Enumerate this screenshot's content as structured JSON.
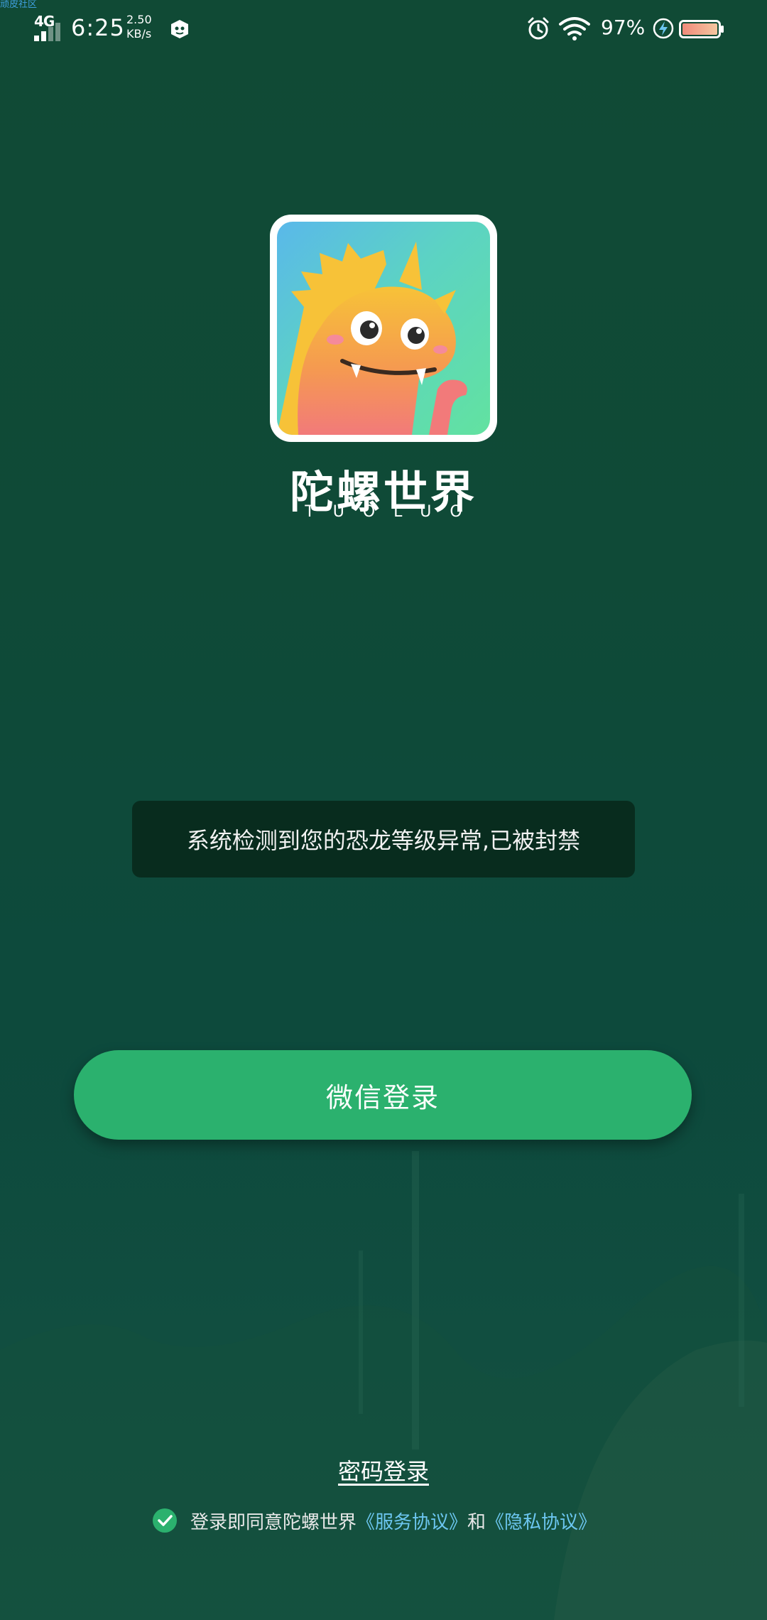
{
  "corner_tag": "顽皮社区",
  "status_bar": {
    "network": "4G",
    "time": "6:25",
    "speed_value": "2.50",
    "speed_unit": "KB/s",
    "battery_percent": "97%"
  },
  "brand": {
    "name": "陀螺世界",
    "subtitle": "TUOLUO"
  },
  "toast": {
    "message": "系统检测到您的恐龙等级异常,已被封禁"
  },
  "login": {
    "wechat_label": "微信登录",
    "password_label": "密码登录"
  },
  "agreement": {
    "prefix": "登录即同意陀螺世界",
    "service_link": "《服务协议》",
    "conjunction": "和",
    "privacy_link": "《隐私协议》",
    "checked": true
  },
  "colors": {
    "background": "#104a35",
    "button": "#2bb16e",
    "link": "#6cc6f0",
    "toast": "#082c1e"
  }
}
